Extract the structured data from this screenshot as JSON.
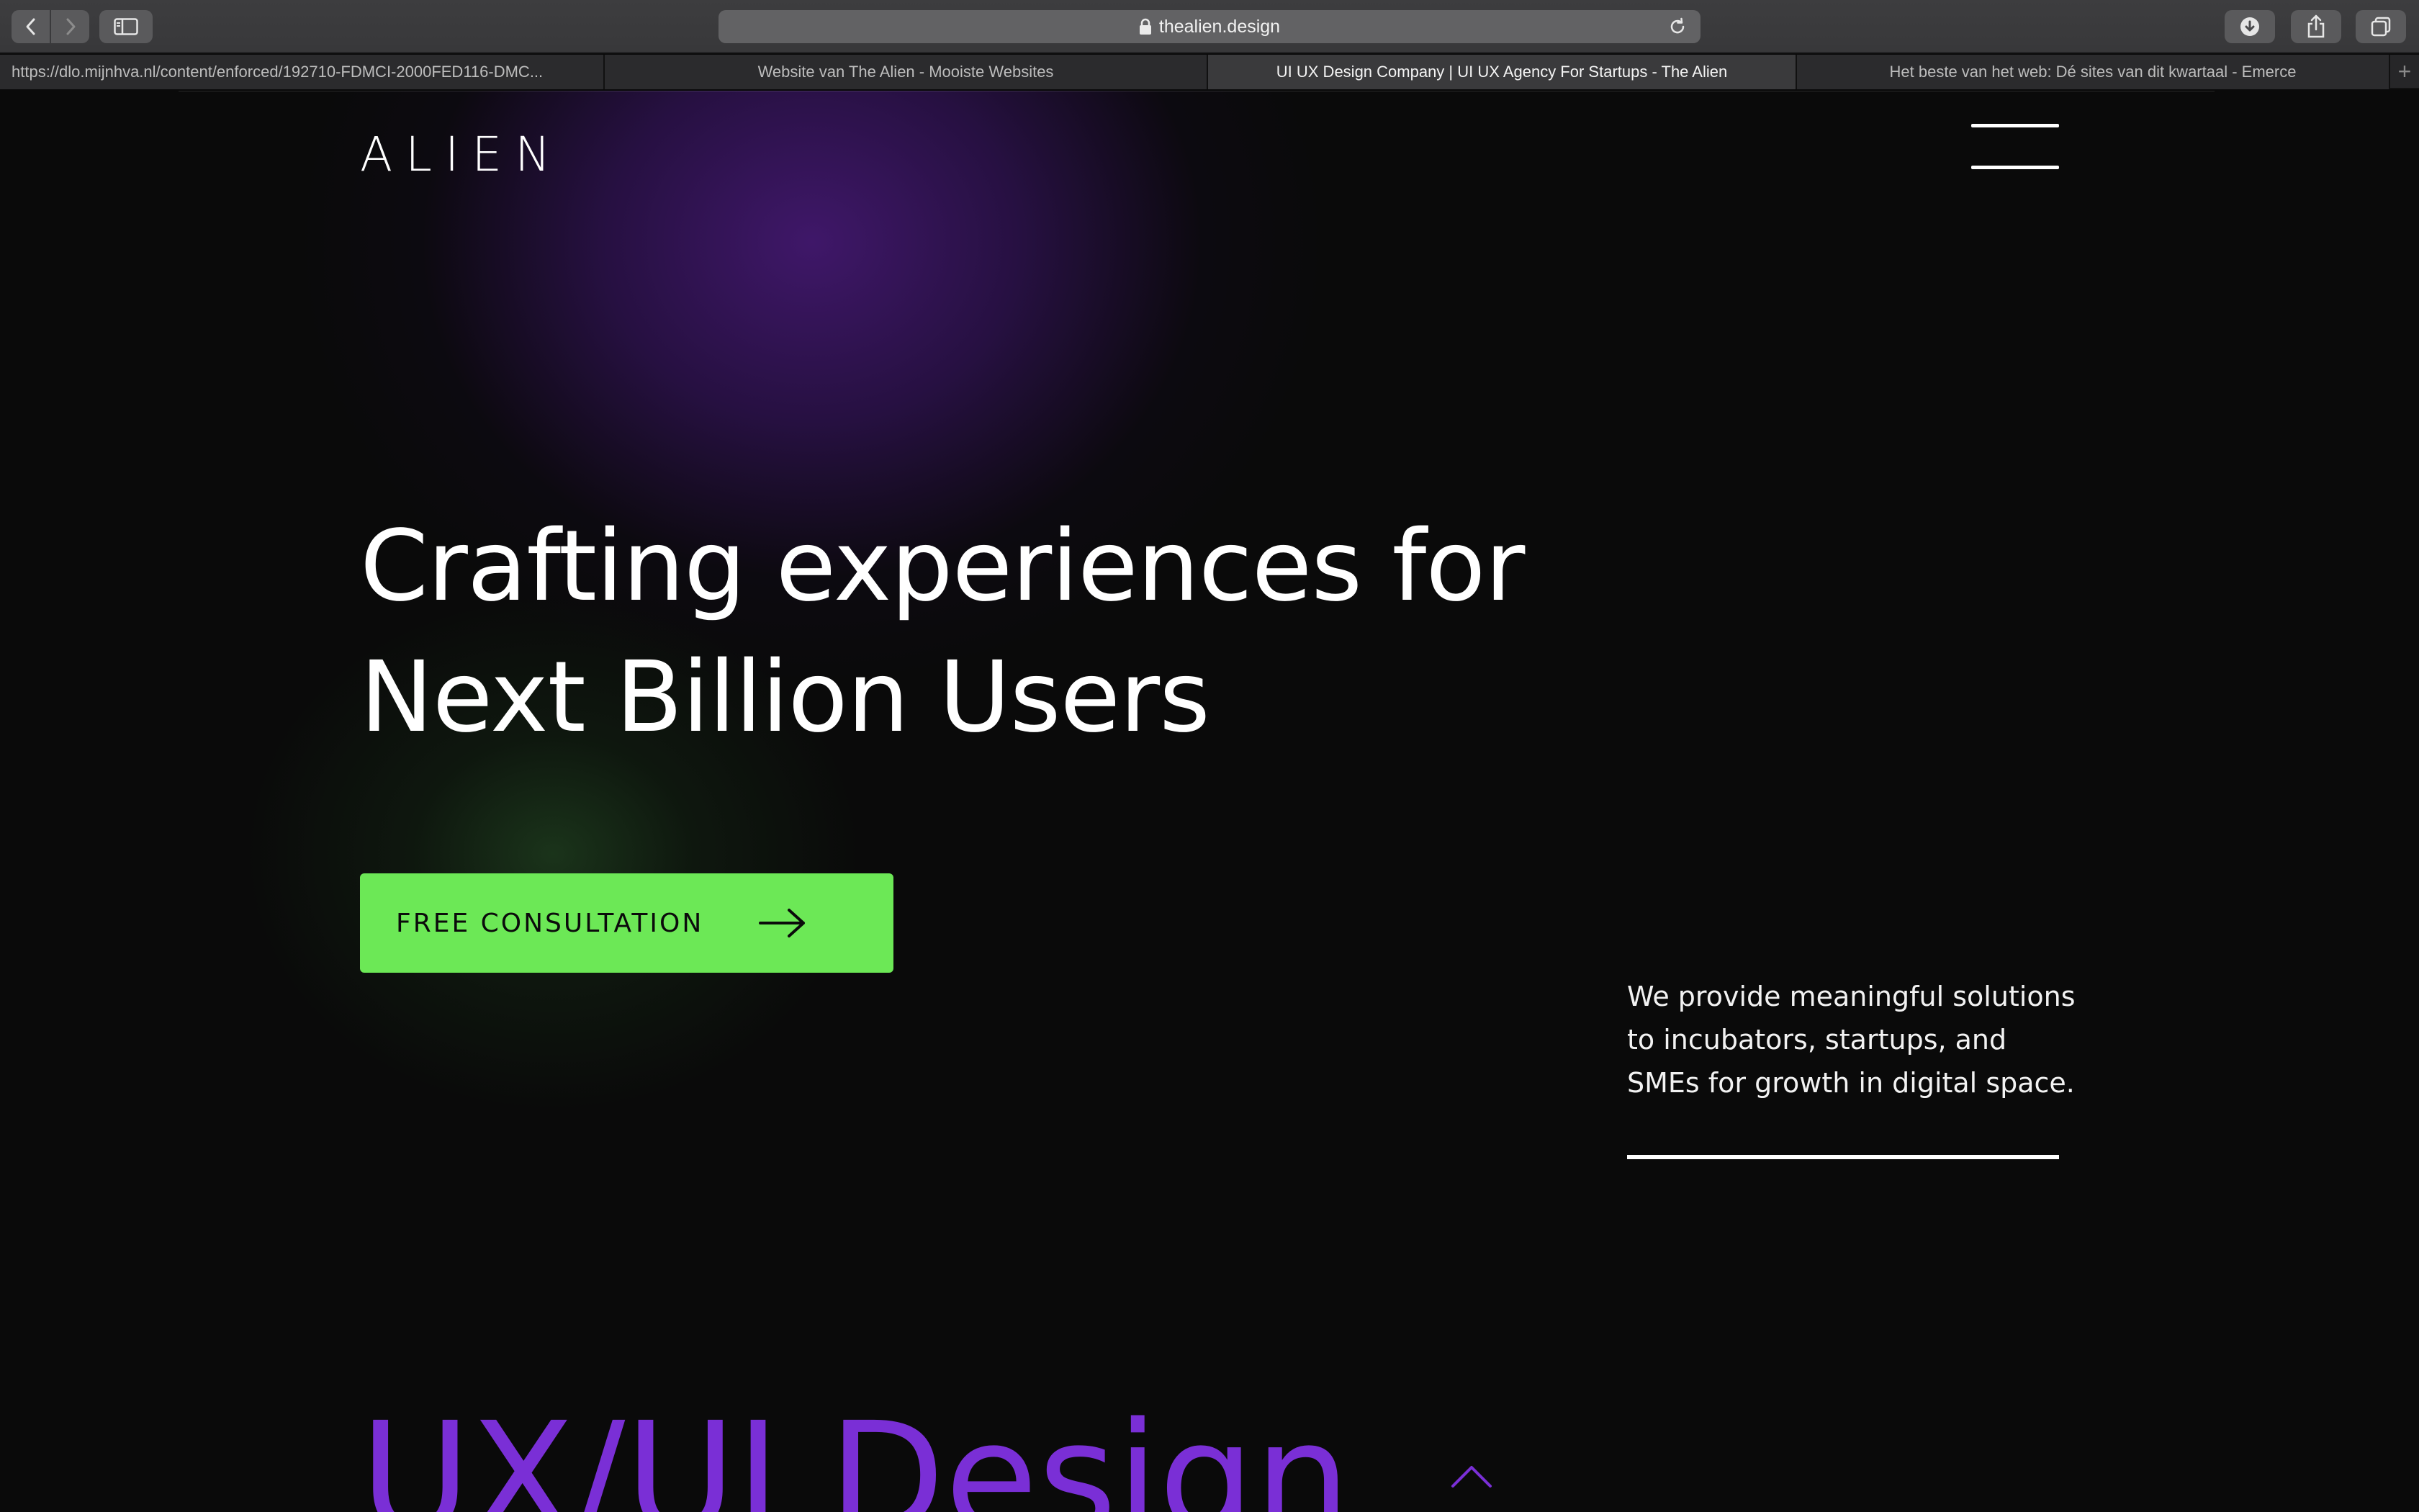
{
  "browser": {
    "url": "thealien.design",
    "tabs": [
      {
        "label": "https://dlo.mijnhva.nl/content/enforced/192710-FDMCI-2000FED116-DMC..."
      },
      {
        "label": "Website van The Alien - Mooiste Websites"
      },
      {
        "label": "UI UX Design Company | UI UX Agency For Startups - The Alien"
      },
      {
        "label": "Het beste van het web: Dé sites van dit kwartaal - Emerce"
      }
    ],
    "active_tab": 2
  },
  "site": {
    "logo": "ALIEN",
    "headline_line1": "Crafting experiences for",
    "headline_line2": "Next Billion Users",
    "cta_label": "FREE CONSULTATION",
    "tagline_line1": "We provide meaningful solutions",
    "tagline_line2": "to incubators, startups, and",
    "tagline_line3": "SMEs for growth in digital space.",
    "section_title": "UX/UI Design"
  },
  "colors": {
    "background": "#0a0a0a",
    "cta": "#6ce856",
    "accent_purple": "#7a2fd6",
    "glow_purple": "#42186e",
    "glow_green": "#285628"
  },
  "icons": [
    "back-arrow-icon",
    "forward-arrow-icon",
    "sidebar-icon",
    "lock-icon",
    "reload-icon",
    "download-icon",
    "share-icon",
    "tabs-overview-icon",
    "hamburger-menu-icon",
    "arrow-right-icon",
    "chevron-up-icon"
  ]
}
